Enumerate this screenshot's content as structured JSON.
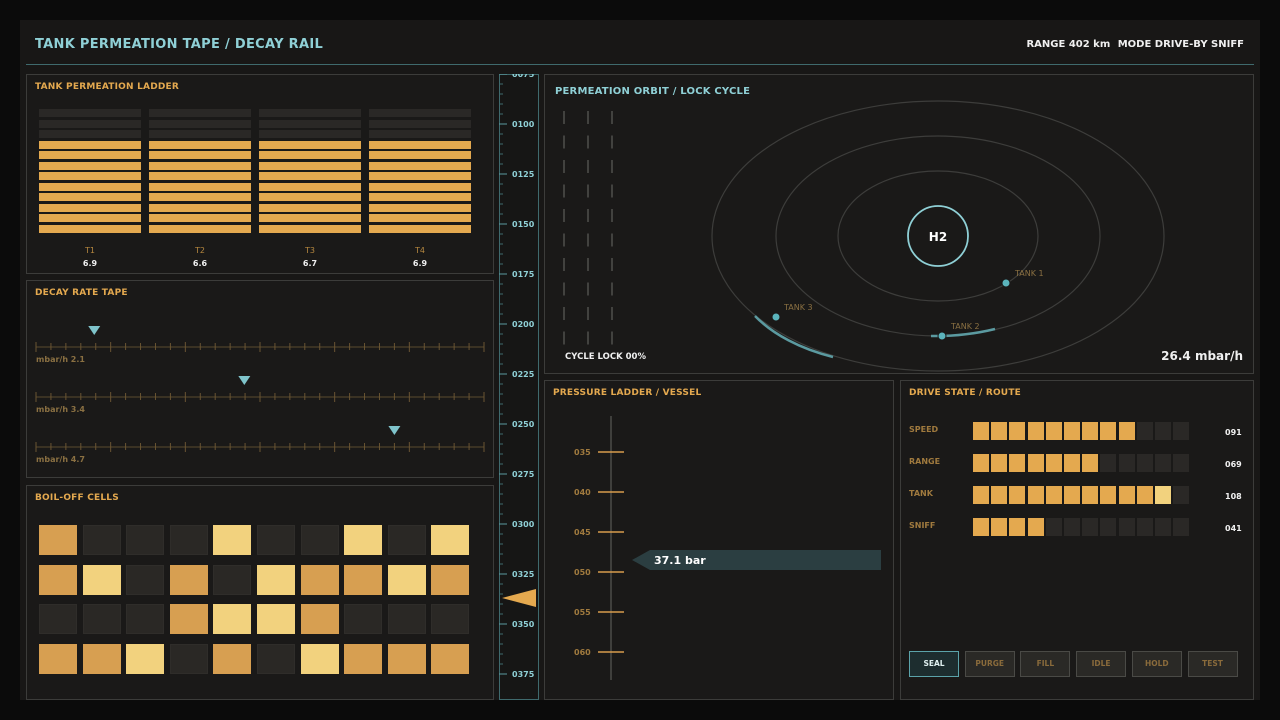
{
  "header": {
    "title": "TANK PERMEATION TAPE / DECAY RAIL",
    "range": "RANGE 402 km",
    "mode": "MODE DRIVE-BY SNIFF"
  },
  "ladder": {
    "title": "TANK PERMEATION LADDER",
    "tanks": [
      {
        "label": "T1",
        "value": "6.9",
        "fill": 0.75
      },
      {
        "label": "T2",
        "value": "6.6",
        "fill": 0.75
      },
      {
        "label": "T3",
        "value": "6.7",
        "fill": 0.75
      },
      {
        "label": "T4",
        "value": "6.9",
        "fill": 0.75
      }
    ]
  },
  "decay": {
    "title": "DECAY RATE TAPE",
    "tapes": [
      {
        "label": "mbar/h 2.1",
        "position": 0.13
      },
      {
        "label": "mbar/h 3.4",
        "position": 0.465
      },
      {
        "label": "mbar/h 4.7",
        "position": 0.8
      }
    ]
  },
  "boiloff": {
    "title": "BOIL-OFF CELLS",
    "rows": [
      [
        2,
        0,
        0,
        0,
        3,
        0,
        0,
        3,
        0,
        3
      ],
      [
        2,
        3,
        0,
        2,
        0,
        3,
        2,
        2,
        3,
        2
      ],
      [
        0,
        0,
        0,
        2,
        3,
        3,
        2,
        0,
        0,
        0
      ],
      [
        2,
        2,
        3,
        0,
        2,
        0,
        3,
        2,
        2,
        2
      ]
    ]
  },
  "rail": {
    "ticks": [
      "0075",
      "0100",
      "0125",
      "0150",
      "0175",
      "0200",
      "0225",
      "0250",
      "0275",
      "0300",
      "0325",
      "0350",
      "0375"
    ],
    "pointer_value": 325
  },
  "orbit": {
    "title": "PERMEATION ORBIT / LOCK CYCLE",
    "center": "H2",
    "cycle_lock": "CYCLE LOCK 00%",
    "rate": "26.4 mbar/h",
    "tanks": [
      "TANK 1",
      "TANK 2",
      "TANK 3"
    ]
  },
  "pressure": {
    "title": "PRESSURE LADDER / VESSEL",
    "ticks": [
      "035",
      "040",
      "045",
      "050",
      "055",
      "060"
    ],
    "readout": "37.1 bar"
  },
  "drive": {
    "title": "DRIVE STATE / ROUTE",
    "rows": [
      {
        "label": "SPEED",
        "value": "091",
        "filled": 9,
        "highlight": -1
      },
      {
        "label": "RANGE",
        "value": "069",
        "filled": 7,
        "highlight": -1
      },
      {
        "label": "TANK",
        "value": "108",
        "filled": 11,
        "highlight": 10
      },
      {
        "label": "SNIFF",
        "value": "041",
        "filled": 4,
        "highlight": -1
      }
    ],
    "buttons": [
      {
        "label": "SEAL",
        "active": true
      },
      {
        "label": "PURGE",
        "active": false
      },
      {
        "label": "FILL",
        "active": false
      },
      {
        "label": "IDLE",
        "active": false
      },
      {
        "label": "HOLD",
        "active": false
      },
      {
        "label": "TEST",
        "active": false
      }
    ]
  },
  "colors": {
    "accent": "#e4a94f",
    "highlight": "#f2d27e",
    "teal": "#8fd0d6",
    "empty": "#2b2926"
  }
}
